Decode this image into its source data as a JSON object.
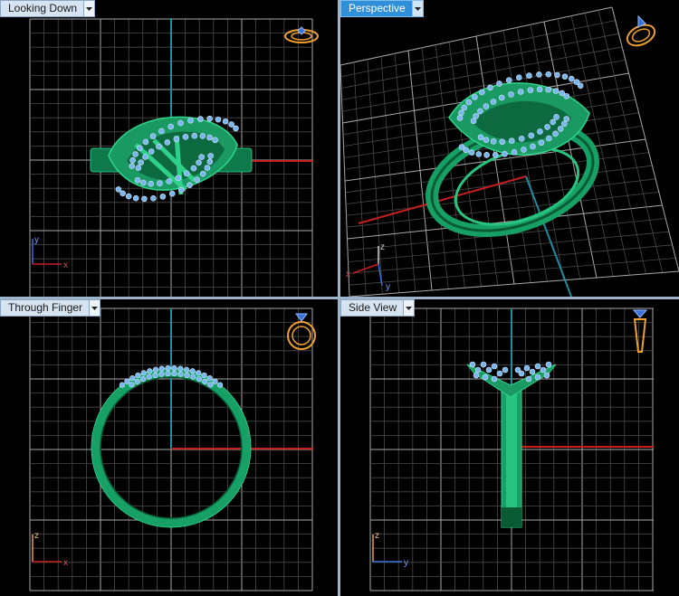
{
  "viewports": {
    "top_left": {
      "label": "Looking Down",
      "active": false
    },
    "top_right": {
      "label": "Perspective",
      "active": true
    },
    "bottom_left": {
      "label": "Through Finger",
      "active": false
    },
    "bottom_right": {
      "label": "Side View",
      "active": false
    }
  },
  "axes": {
    "looking_down": {
      "a": "y",
      "b": "x"
    },
    "perspective": {
      "a": "z",
      "b": "y",
      "c": "x"
    },
    "through_finger": {
      "a": "z",
      "b": "x"
    },
    "side_view": {
      "a": "z",
      "b": "y"
    }
  },
  "colors": {
    "grid_minor": "#4a4a4a",
    "grid_major": "#a8a8a8",
    "axis_red": "#c81e1e",
    "axis_teal": "#1b8ea0",
    "ring_metal": "#1fa46a",
    "ring_dark": "#0b6b42",
    "gem": "#79b6ec",
    "nav_orange": "#f0a030",
    "nav_blue": "#3a6fd8"
  },
  "icons": {
    "view_cube": "ring-view-cube-icon",
    "dropdown": "chevron-down-icon"
  }
}
